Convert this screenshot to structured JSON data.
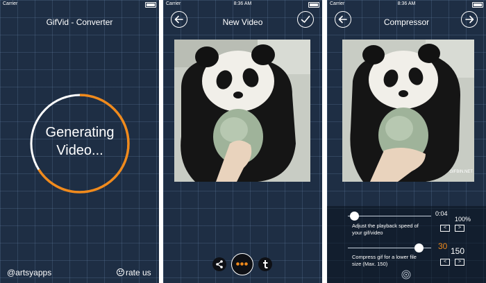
{
  "status_bar": {
    "carrier": "Carrier",
    "screens": [
      {
        "time": ""
      },
      {
        "time": "8:36 AM"
      },
      {
        "time": "8:36 AM"
      }
    ]
  },
  "screen1": {
    "title": "GifVid - Converter",
    "generating_line1": "Generating",
    "generating_line2": "Video...",
    "progress": 0.66,
    "handle": "@artsyapps",
    "rate": "rate us"
  },
  "screen2": {
    "title": "New Video"
  },
  "screen3": {
    "title": "Compressor",
    "watermark": "GIFBIN.NET",
    "speed_time": "0:04",
    "speed_percent": "100%",
    "speed_label_1": "Adjust the playback speed of",
    "speed_label_2": "your gif/video",
    "compress_value": "30",
    "compress_max": "150",
    "compress_label_1": "Compress gif for a lower file",
    "compress_label_2": "size (Max. 150)",
    "stepper_left": "<",
    "stepper_right": ">",
    "speed_slider": 0.08,
    "compress_slider": 0.85
  },
  "icons": {
    "back": "arrow-left-icon",
    "forward": "arrow-right-icon",
    "confirm": "checkmark-icon",
    "share": "share-icon",
    "more": "more-dots-icon",
    "tumblr": "tumblr-icon",
    "settings": "settings-icon"
  },
  "colors": {
    "background": "#1e2e44",
    "accent": "#f08a1c",
    "grid": "#5a7090"
  }
}
